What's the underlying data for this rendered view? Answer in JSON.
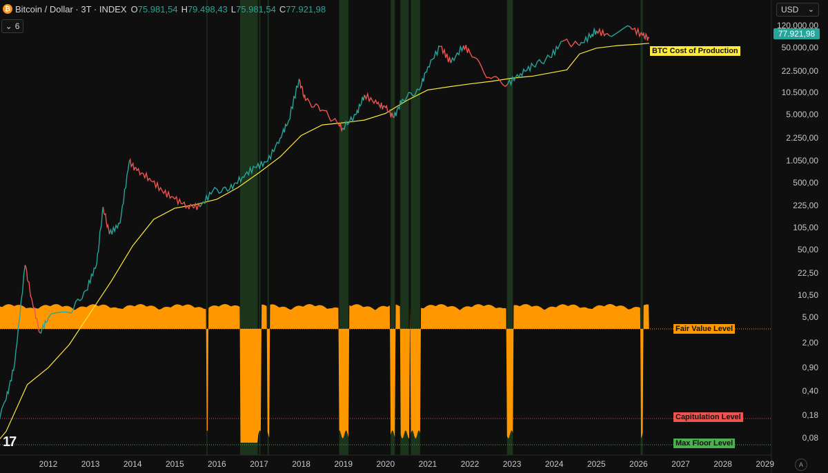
{
  "header": {
    "coin_icon_glyph": "₿",
    "symbol": "Bitcoin / Dollar · 3T · INDEX",
    "o_label": "O",
    "o_value": "75.981,54",
    "h_label": "H",
    "h_value": "79.498,43",
    "l_label": "L",
    "l_value": "75.981,54",
    "c_label": "C",
    "c_value": "77.921,98"
  },
  "controls": {
    "collapse_label": "6",
    "currency": "USD",
    "auto_label": "A"
  },
  "last_price": "77.921,98",
  "colors": {
    "background": "#0f0f0f",
    "up": "#26a69a",
    "down": "#ef5350",
    "cost_line": "#ffeb3b",
    "oscillator": "#ff9800",
    "highlight": "#1e3a1e"
  },
  "chart_data": [
    {
      "type": "line",
      "title": "Bitcoin / Dollar · 3T · INDEX",
      "scale": "log",
      "y_ticks": [
        "120.000,00",
        "50.000,00",
        "22.500,00",
        "10.500,00",
        "5.000,00",
        "2.250,00",
        "1.050,00",
        "500,00",
        "225,00",
        "105,00",
        "50,00",
        "22,50",
        "10,50",
        "5,00",
        "2,00",
        "0,90",
        "0,40",
        "0,18",
        "0,08"
      ],
      "x_ticks": [
        "2012",
        "2013",
        "2014",
        "2015",
        "2016",
        "2017",
        "2018",
        "2019",
        "2020",
        "2021",
        "2022",
        "2023",
        "2024",
        "2025",
        "2026",
        "2027",
        "2028",
        "2029"
      ],
      "series": [
        {
          "name": "Bitcoin / Dollar",
          "x": [
            2010.6,
            2011.0,
            2011.2,
            2011.45,
            2011.6,
            2011.8,
            2012.0,
            2012.5,
            2012.9,
            2013.15,
            2013.3,
            2013.45,
            2013.7,
            2013.92,
            2014.1,
            2014.4,
            2014.7,
            2015.0,
            2015.3,
            2015.6,
            2015.9,
            2016.3,
            2016.6,
            2016.9,
            2017.2,
            2017.5,
            2017.7,
            2017.95,
            2018.1,
            2018.5,
            2018.9,
            2018.98,
            2019.3,
            2019.5,
            2019.8,
            2020.0,
            2020.2,
            2020.4,
            2020.8,
            2021.0,
            2021.3,
            2021.55,
            2021.85,
            2022.0,
            2022.45,
            2022.9,
            2023.2,
            2023.5,
            2023.9,
            2024.2,
            2024.6,
            2024.9,
            2025.0,
            2025.3,
            2025.8,
            2026.1,
            2026.25
          ],
          "y": [
            0.06,
            0.3,
            1,
            31,
            10,
            3,
            5,
            6,
            13,
            33,
            230,
            90,
            130,
            1100,
            800,
            620,
            400,
            300,
            240,
            230,
            400,
            420,
            650,
            900,
            1100,
            2500,
            4500,
            19000,
            9000,
            6500,
            3800,
            3500,
            5500,
            11000,
            8000,
            7000,
            5000,
            9500,
            13000,
            29000,
            58000,
            33000,
            60000,
            47000,
            20000,
            16000,
            23000,
            30000,
            40000,
            70000,
            60000,
            90000,
            100000,
            85000,
            115000,
            85000,
            77921.98
          ]
        },
        {
          "name": "BTC Cost of Production",
          "x": [
            2010.6,
            2011.0,
            2011.5,
            2012.0,
            2012.5,
            2013.0,
            2013.5,
            2014.0,
            2014.5,
            2015.0,
            2015.5,
            2016.0,
            2016.5,
            2017.0,
            2017.5,
            2018.0,
            2018.5,
            2019.0,
            2019.5,
            2020.0,
            2020.5,
            2021.0,
            2021.5,
            2022.0,
            2022.5,
            2023.0,
            2023.5,
            2024.0,
            2024.3,
            2024.6,
            2025.0,
            2025.5,
            2026.0,
            2026.25
          ],
          "y": [
            0.05,
            0.1,
            0.5,
            0.9,
            2,
            6,
            18,
            60,
            150,
            220,
            250,
            300,
            450,
            750,
            1300,
            2700,
            3900,
            4200,
            4600,
            5800,
            9000,
            13000,
            14500,
            16000,
            17500,
            19500,
            21000,
            24000,
            26000,
            45000,
            55000,
            60000,
            63000,
            65000
          ]
        }
      ]
    },
    {
      "type": "area",
      "title": "",
      "levels": [
        "Fair Value Level",
        "Capitulation Level",
        "Max Floor Level"
      ],
      "series_note": "oscillator",
      "highlight_periods": [
        [
          2015.75,
          2015.77
        ],
        [
          2016.55,
          2016.97
        ],
        [
          2017.0,
          2017.03
        ],
        [
          2017.2,
          2017.23
        ],
        [
          2018.9,
          2019.12
        ],
        [
          2020.12,
          2020.22
        ],
        [
          2020.35,
          2020.55
        ],
        [
          2020.6,
          2020.82
        ],
        [
          2022.88,
          2023.02
        ],
        [
          2026.05,
          2026.1
        ]
      ],
      "labels": [
        {
          "text": "BTC Cost of Production",
          "color": "#ffeb3b"
        },
        {
          "text": "Fair Value Level",
          "color": "#ff9800"
        },
        {
          "text": "Capitulation Level",
          "color": "#ef5350"
        },
        {
          "text": "Max Floor Level",
          "color": "#4caf50"
        }
      ]
    }
  ]
}
